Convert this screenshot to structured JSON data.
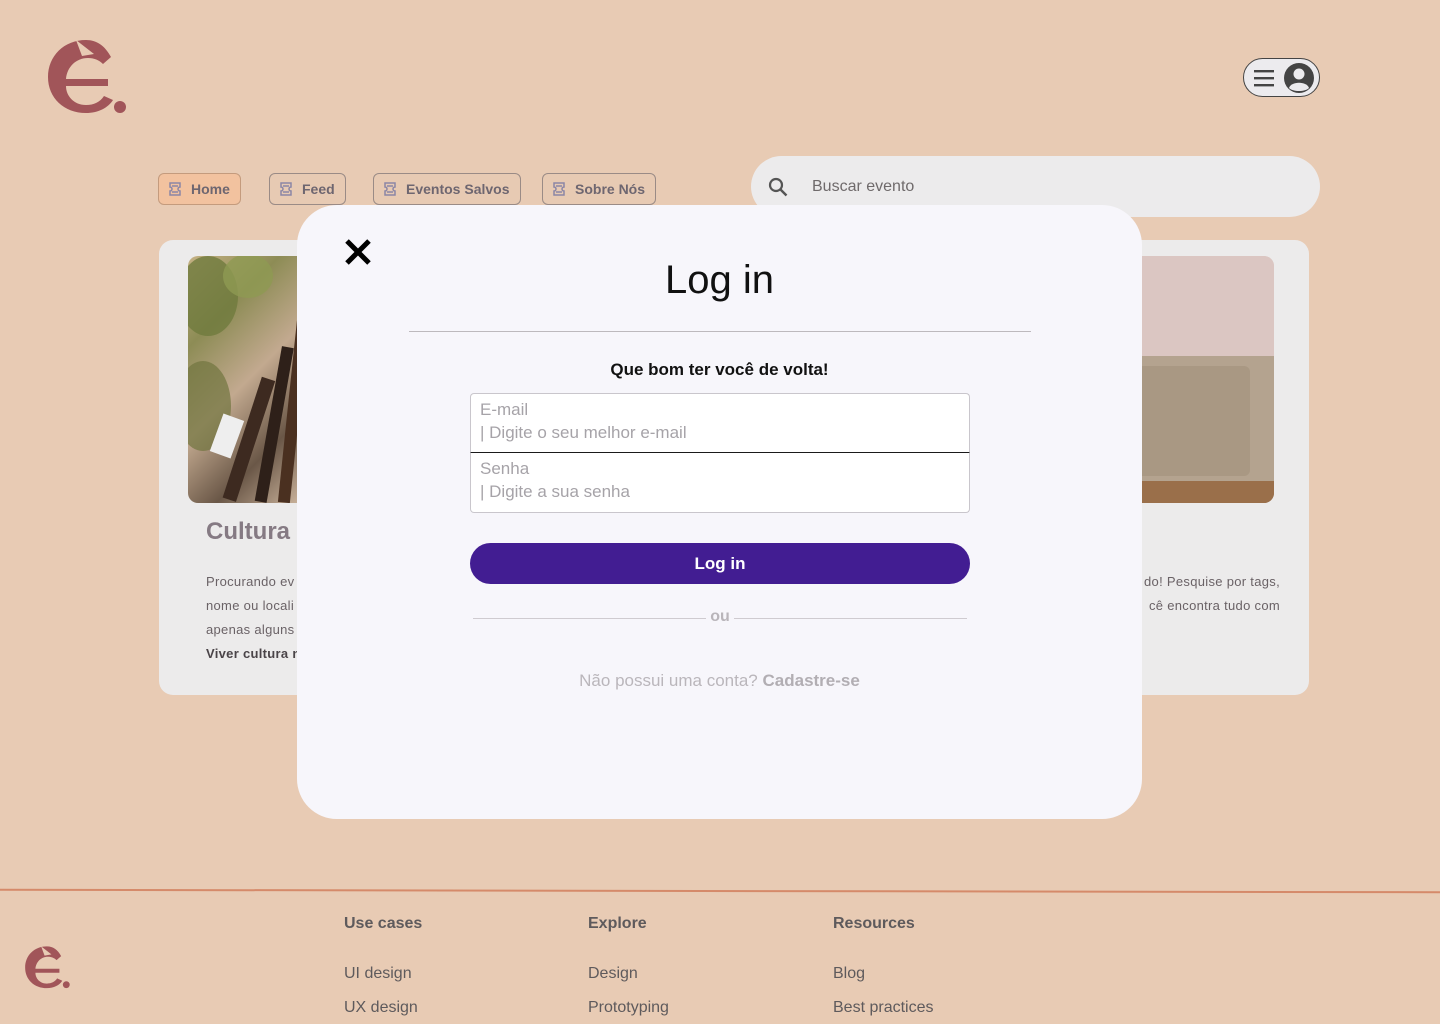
{
  "header": {
    "menu_icon": "hamburger-icon",
    "profile_icon": "user-circle-icon"
  },
  "nav": {
    "tabs": [
      {
        "label": "Home",
        "icon": "ticket-icon",
        "active": true
      },
      {
        "label": "Feed",
        "icon": "ticket-icon",
        "active": false
      },
      {
        "label": "Eventos Salvos",
        "icon": "ticket-icon",
        "active": false
      },
      {
        "label": "Sobre Nós",
        "icon": "ticket-icon",
        "active": false
      }
    ]
  },
  "search": {
    "placeholder": "Buscar evento",
    "icon": "search-icon"
  },
  "card": {
    "title": "Cultura e",
    "left_lines": [
      "Procurando ev",
      "nome ou locali",
      "apenas alguns"
    ],
    "left_bold": "Viver cultura n",
    "right_lines": [
      "do! Pesquise por tags,",
      "cê encontra tudo com"
    ]
  },
  "modal": {
    "title": "Log in",
    "welcome": "Que bom ter você de volta!",
    "email_label": "E-mail",
    "email_hint": "| Digite o seu melhor e-mail",
    "password_label": "Senha",
    "password_hint": "| Digite a sua senha",
    "login_button": "Log in",
    "divider_text": "ou",
    "signup_prompt": "Não possui uma conta?",
    "signup_link": "Cadastre-se",
    "close_icon": "close-icon"
  },
  "footer": {
    "columns": [
      {
        "heading": "Use cases",
        "links": [
          "UI design",
          "UX design"
        ]
      },
      {
        "heading": "Explore",
        "links": [
          "Design",
          "Prototyping"
        ]
      },
      {
        "heading": "Resources",
        "links": [
          "Blog",
          "Best practices"
        ]
      }
    ]
  },
  "colors": {
    "background": "#e8cbb4",
    "brand": "#a15559",
    "primary_button": "#421d92",
    "modal": "#f7f6fb",
    "active_tab": "#f2c29f"
  }
}
